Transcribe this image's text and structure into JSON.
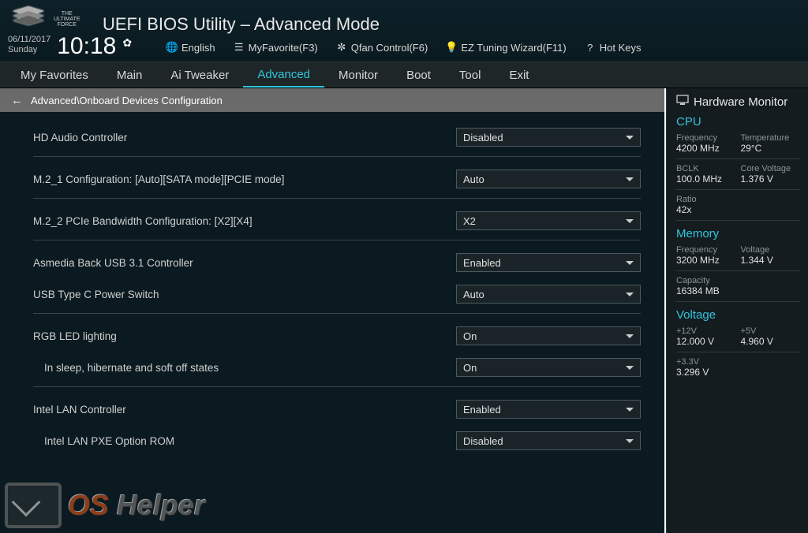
{
  "header": {
    "logo_lines": [
      "THE",
      "ULTIMATE",
      "FORCE"
    ],
    "title": "UEFI BIOS Utility – Advanced Mode",
    "date": "06/11/2017",
    "day": "Sunday",
    "time": "10:18",
    "toolbar": {
      "language": "English",
      "favorite": "MyFavorite(F3)",
      "qfan": "Qfan Control(F6)",
      "eztune": "EZ Tuning Wizard(F11)",
      "hotkeys": "Hot Keys"
    }
  },
  "nav": {
    "tabs": [
      "My Favorites",
      "Main",
      "Ai Tweaker",
      "Advanced",
      "Monitor",
      "Boot",
      "Tool",
      "Exit"
    ],
    "active_index": 3
  },
  "breadcrumb": "Advanced\\Onboard Devices Configuration",
  "settings": [
    {
      "label": "HD Audio Controller",
      "value": "Disabled",
      "indent": false,
      "divider_after": true
    },
    {
      "label": "M.2_1 Configuration: [Auto][SATA mode][PCIE mode]",
      "value": "Auto",
      "indent": false,
      "divider_after": true
    },
    {
      "label": "M.2_2 PCIe Bandwidth Configuration: [X2][X4]",
      "value": "X2",
      "indent": false,
      "divider_after": true
    },
    {
      "label": "Asmedia Back USB 3.1 Controller",
      "value": "Enabled",
      "indent": false,
      "divider_after": false
    },
    {
      "label": "USB Type C Power Switch",
      "value": "Auto",
      "indent": false,
      "divider_after": true
    },
    {
      "label": "RGB LED lighting",
      "value": "On",
      "indent": false,
      "divider_after": false
    },
    {
      "label": "In sleep, hibernate and soft off states",
      "value": "On",
      "indent": true,
      "divider_after": true
    },
    {
      "label": "Intel LAN Controller",
      "value": "Enabled",
      "indent": false,
      "divider_after": false
    },
    {
      "label": "Intel LAN PXE Option ROM",
      "value": "Disabled",
      "indent": true,
      "divider_after": false
    }
  ],
  "sidebar": {
    "title": "Hardware Monitor",
    "cpu": {
      "heading": "CPU",
      "freq_k": "Frequency",
      "freq_v": "4200 MHz",
      "temp_k": "Temperature",
      "temp_v": "29°C",
      "bclk_k": "BCLK",
      "bclk_v": "100.0 MHz",
      "cv_k": "Core Voltage",
      "cv_v": "1.376 V",
      "ratio_k": "Ratio",
      "ratio_v": "42x"
    },
    "memory": {
      "heading": "Memory",
      "freq_k": "Frequency",
      "freq_v": "3200 MHz",
      "volt_k": "Voltage",
      "volt_v": "1.344 V",
      "cap_k": "Capacity",
      "cap_v": "16384 MB"
    },
    "voltage": {
      "heading": "Voltage",
      "v12_k": "+12V",
      "v12_v": "12.000 V",
      "v5_k": "+5V",
      "v5_v": "4.960 V",
      "v33_k": "+3.3V",
      "v33_v": "3.296 V"
    }
  },
  "watermark": {
    "os": "OS",
    "rest": " Helper"
  }
}
